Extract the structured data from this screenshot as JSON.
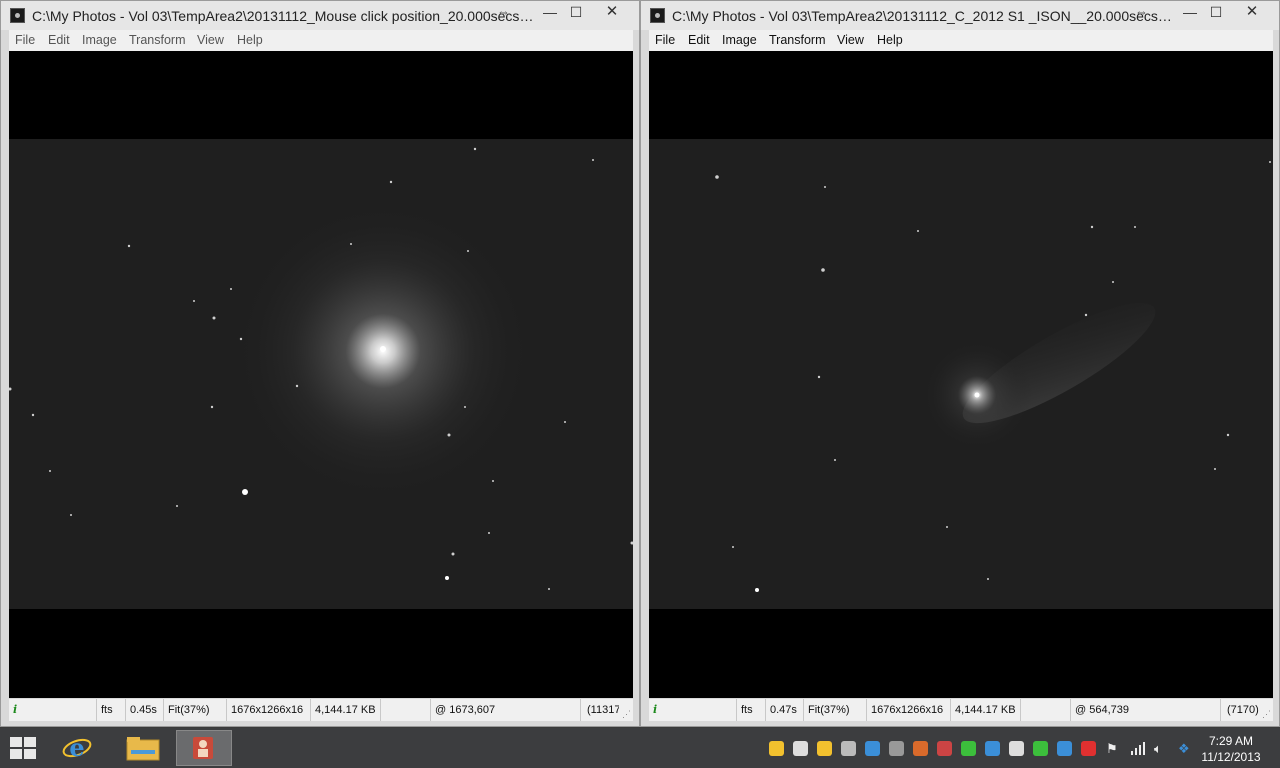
{
  "left_window": {
    "title": "C:\\My Photos - Vol 03\\TempArea2\\20131112_Mouse click position_20.000secs_...",
    "menu": [
      "File",
      "Edit",
      "Image",
      "Transform",
      "View",
      "Help"
    ],
    "status": {
      "info": "i",
      "format": "fts",
      "load_time": "0.45s",
      "zoom": "Fit(37%)",
      "dimensions": "1676x1266x16",
      "file_size": "4,144.17 KB",
      "position": "@ 1673,607",
      "value": "(11317"
    }
  },
  "right_window": {
    "title": "C:\\My Photos - Vol 03\\TempArea2\\20131112_C_2012 S1 _ISON__20.000secs_2x...",
    "menu": [
      "File",
      "Edit",
      "Image",
      "Transform",
      "View",
      "Help"
    ],
    "status": {
      "info": "i",
      "format": "fts",
      "load_time": "0.47s",
      "zoom": "Fit(37%)",
      "dimensions": "1676x1266x16",
      "file_size": "4,144.17 KB",
      "position": "@ 564,739",
      "value": "(7170)"
    }
  },
  "window_controls": {
    "minimize": "—",
    "maximize": "☐",
    "close": "✕"
  },
  "taskbar": {
    "apps": [
      "internet-explorer-icon",
      "file-explorer-icon",
      "image-viewer-icon"
    ],
    "tray_icon_colors": [
      "#f2c12e",
      "#dddddd",
      "#f2c12e",
      "#bbbbbb",
      "#3b8fd8",
      "#999999",
      "#d96a2b",
      "#cc4444",
      "#3cbf3c",
      "#3b8fd8",
      "#dddddd",
      "#3cbf3c",
      "#3b8fd8",
      "#e03030"
    ],
    "time": "7:29 AM",
    "date": "11/12/2013"
  },
  "colors": {
    "titlebar": "#e6e6e6",
    "menubar": "#f0f0f0",
    "taskbar": "#3c3d3f",
    "sky": "#1f1f1f"
  }
}
